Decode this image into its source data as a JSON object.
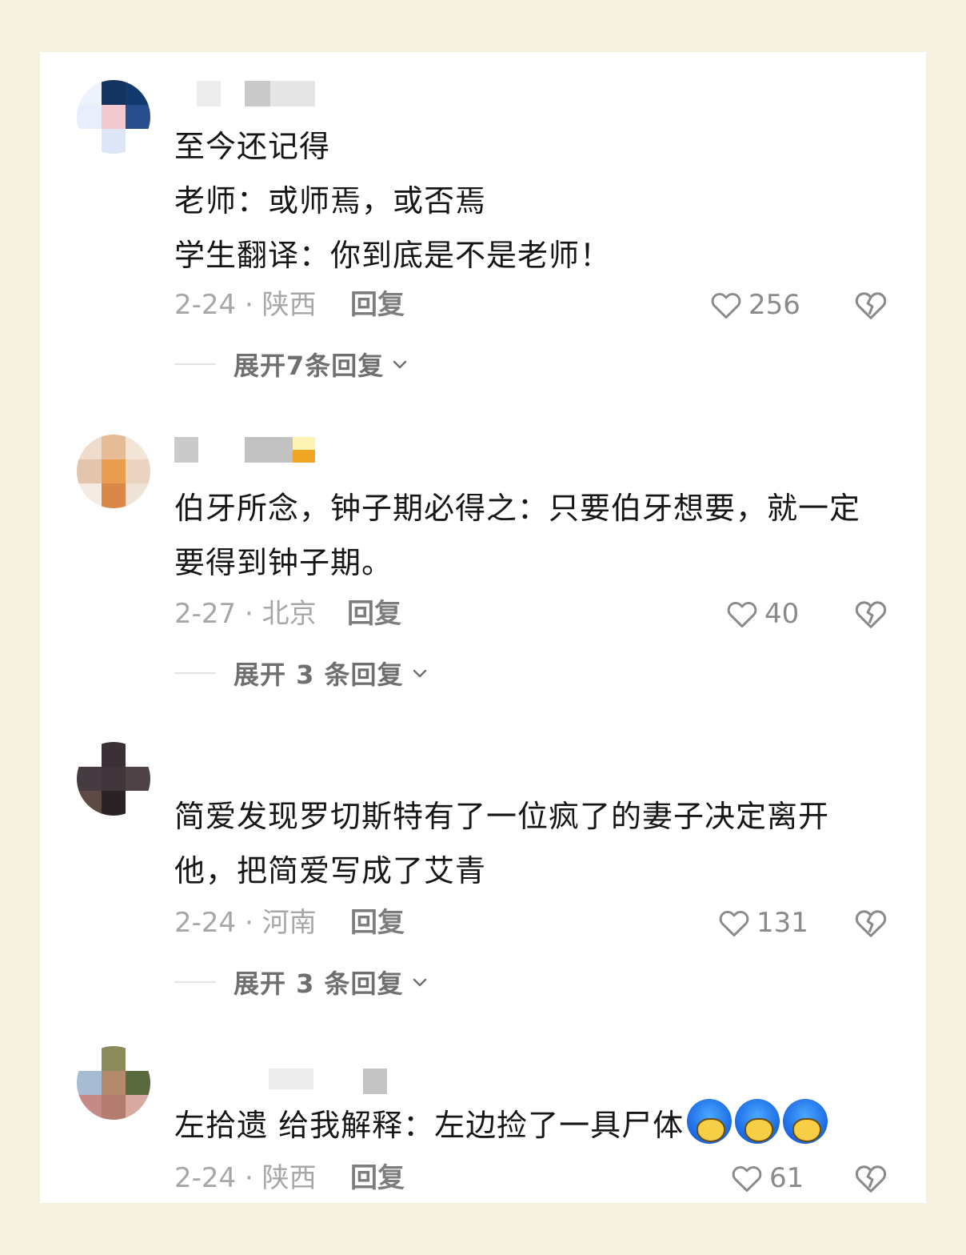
{
  "comments": [
    {
      "text_lines": [
        "至今还记得",
        "老师：或师焉，或否焉",
        "学生翻译：你到底是不是老师！"
      ],
      "date_location": "2-24 · 陕西",
      "reply_label": "回复",
      "likes": "256",
      "expand_label": "展开7条回复",
      "avatar_colors": [
        "#eef2fa",
        "#13345f",
        "#123a6e",
        "#e8eefb",
        "#f2c9d0",
        "#274d8d",
        "#ffffff",
        "#dce6f6",
        "#ffffff"
      ]
    },
    {
      "text_lines": [
        "伯牙所念，钟子期必得之：只要伯牙想要，就一定",
        "要得到钟子期。"
      ],
      "date_location": "2-27 · 北京",
      "reply_label": "回复",
      "likes": "40",
      "expand_label": "展开 3 条回复",
      "avatar_colors": [
        "#f0dccd",
        "#e6bc96",
        "#f2e4d6",
        "#e3c4ad",
        "#e89d4f",
        "#ead4c0",
        "#f4ece4",
        "#d9884a",
        "#efe3d7"
      ]
    },
    {
      "text_lines": [
        "简爱发现罗切斯特有了一位疯了的妻子决定离开",
        "他，把简爱写成了艾青"
      ],
      "date_location": "2-24 · 河南",
      "reply_label": "回复",
      "likes": "131",
      "expand_label": "展开 3 条回复",
      "avatar_colors": [
        "#ffffff",
        "#3a3036",
        "#ffffff",
        "#463b41",
        "#40353a",
        "#4e4247",
        "#5c4a44",
        "#2a2224",
        "#ffffff"
      ]
    },
    {
      "text_lines": [
        "左拾遗 给我解释：左边捡了一具尸体"
      ],
      "emoji_count": 3,
      "emoji_name": "shy-blue-hair-emoji",
      "date_location": "2-24 · 陕西",
      "reply_label": "回复",
      "likes": "61",
      "avatar_colors": [
        "#ffffff",
        "#8a8a5a",
        "#ffffff",
        "#a7bcd3",
        "#b38a6c",
        "#5a6a3e",
        "#c58a86",
        "#b37c6e",
        "#d7a9a0"
      ]
    }
  ],
  "icons": {
    "like": "heart-outline-icon",
    "dislike": "broken-heart-icon",
    "expand": "chevron-down-icon"
  },
  "colors": {
    "page_background": "#f5f1e1",
    "card_background": "#ffffff",
    "meta_gray": "#a7a7a7",
    "icon_gray": "#8a8a8a"
  }
}
